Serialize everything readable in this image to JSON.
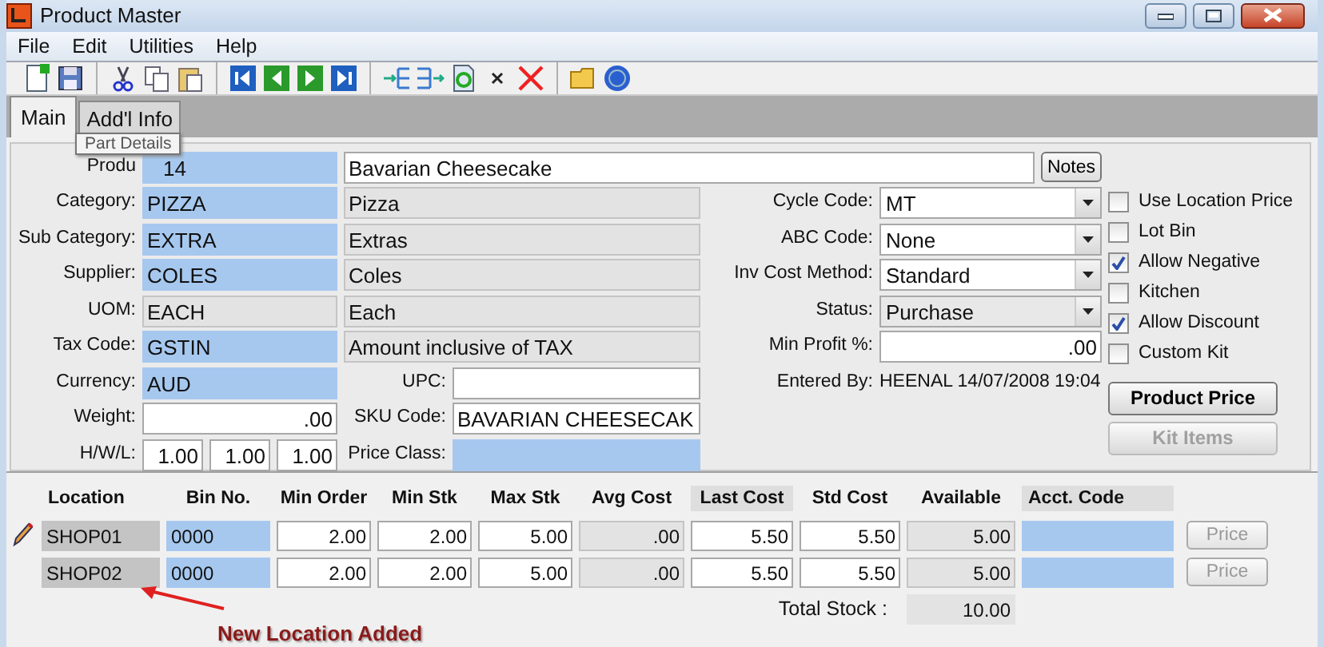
{
  "window": {
    "title": "Product Master"
  },
  "menu": [
    "File",
    "Edit",
    "Utilities",
    "Help"
  ],
  "tabs": [
    {
      "label": "Main",
      "selected": true
    },
    {
      "label": "Add'l Info",
      "selected": false
    }
  ],
  "tooltip": {
    "text": "Part Details"
  },
  "product": {
    "label": "Produ",
    "code": "14",
    "description": "Bavarian Cheesecake",
    "notes_button": "Notes"
  },
  "lookups": [
    {
      "label": "Category:",
      "code": "PIZZA",
      "description": "Pizza",
      "kind": "lookup"
    },
    {
      "label": "Sub Category:",
      "code": "EXTRA",
      "description": "Extras",
      "kind": "lookup"
    },
    {
      "label": "Supplier:",
      "code": "COLES",
      "description": "Coles",
      "kind": "lookup"
    },
    {
      "label": "UOM:",
      "code": "EACH",
      "description": "Each",
      "kind": "readonly"
    },
    {
      "label": "Tax Code:",
      "code": "GSTIN",
      "description": "Amount inclusive of TAX",
      "kind": "lookup"
    },
    {
      "label": "Currency:",
      "code": "AUD",
      "kind": "lookup"
    }
  ],
  "weight": {
    "label": "Weight:",
    "value": ".00"
  },
  "dimensions": {
    "label": "H/W/L:",
    "values": [
      "1.00",
      "1.00",
      "1.00"
    ]
  },
  "codes": [
    {
      "label": "UPC:",
      "kind": "text"
    },
    {
      "label": "SKU Code:",
      "value": "BAVARIAN CHEESECAK",
      "kind": "text"
    },
    {
      "label": "Price Class:",
      "kind": "lookup"
    }
  ],
  "settings": [
    {
      "label": "Cycle Code:",
      "value": "MT",
      "kind": "select",
      "disabled": false
    },
    {
      "label": "ABC Code:",
      "value": "None",
      "kind": "select",
      "disabled": false
    },
    {
      "label": "Inv Cost Method:",
      "value": "Standard",
      "kind": "select",
      "disabled": false
    },
    {
      "label": "Status:",
      "value": "Purchase",
      "kind": "select",
      "disabled": true
    },
    {
      "label": "Min Profit %:",
      "value": ".00",
      "kind": "number"
    },
    {
      "label": "Entered By:",
      "value": "HEENAL 14/07/2008 19:04",
      "kind": "info"
    }
  ],
  "options": [
    {
      "label": "Use Location Price",
      "checked": false
    },
    {
      "label": "Lot Bin",
      "checked": false
    },
    {
      "label": "Allow Negative",
      "checked": true
    },
    {
      "label": "Kitchen",
      "checked": false
    },
    {
      "label": "Allow Discount",
      "checked": true
    },
    {
      "label": "Custom Kit",
      "checked": false
    }
  ],
  "buttons": [
    {
      "label": "Product Price",
      "disabled": false
    },
    {
      "label": "Kit Items",
      "disabled": true
    }
  ],
  "locations": {
    "columns": [
      {
        "label": "Location",
        "shaded": false
      },
      {
        "label": "Bin No.",
        "shaded": false
      },
      {
        "label": "Min Order",
        "shaded": false
      },
      {
        "label": "Min Stk",
        "shaded": false
      },
      {
        "label": "Max Stk",
        "shaded": false
      },
      {
        "label": "Avg Cost",
        "shaded": false
      },
      {
        "label": "Last Cost",
        "shaded": true
      },
      {
        "label": "Std Cost",
        "shaded": false
      },
      {
        "label": "Available",
        "shaded": false
      },
      {
        "label": "Acct. Code",
        "shaded": true
      }
    ],
    "rows": [
      {
        "editing": true,
        "location": "SHOP01",
        "bin": "0000",
        "min_order": "2.00",
        "min_stk": "2.00",
        "max_stk": "5.00",
        "avg_cost": ".00",
        "last_cost": "5.50",
        "std_cost": "5.50",
        "available": "5.00",
        "price": {
          "label": "Price",
          "disabled": true
        }
      },
      {
        "editing": false,
        "location": "SHOP02",
        "bin": "0000",
        "min_order": "2.00",
        "min_stk": "2.00",
        "max_stk": "5.00",
        "avg_cost": ".00",
        "last_cost": "5.50",
        "std_cost": "5.50",
        "available": "5.00",
        "price": {
          "label": "Price",
          "disabled": true
        }
      }
    ],
    "total": {
      "label": "Total Stock :",
      "value": "10.00"
    }
  },
  "annotation": {
    "text": "New Location Added"
  }
}
